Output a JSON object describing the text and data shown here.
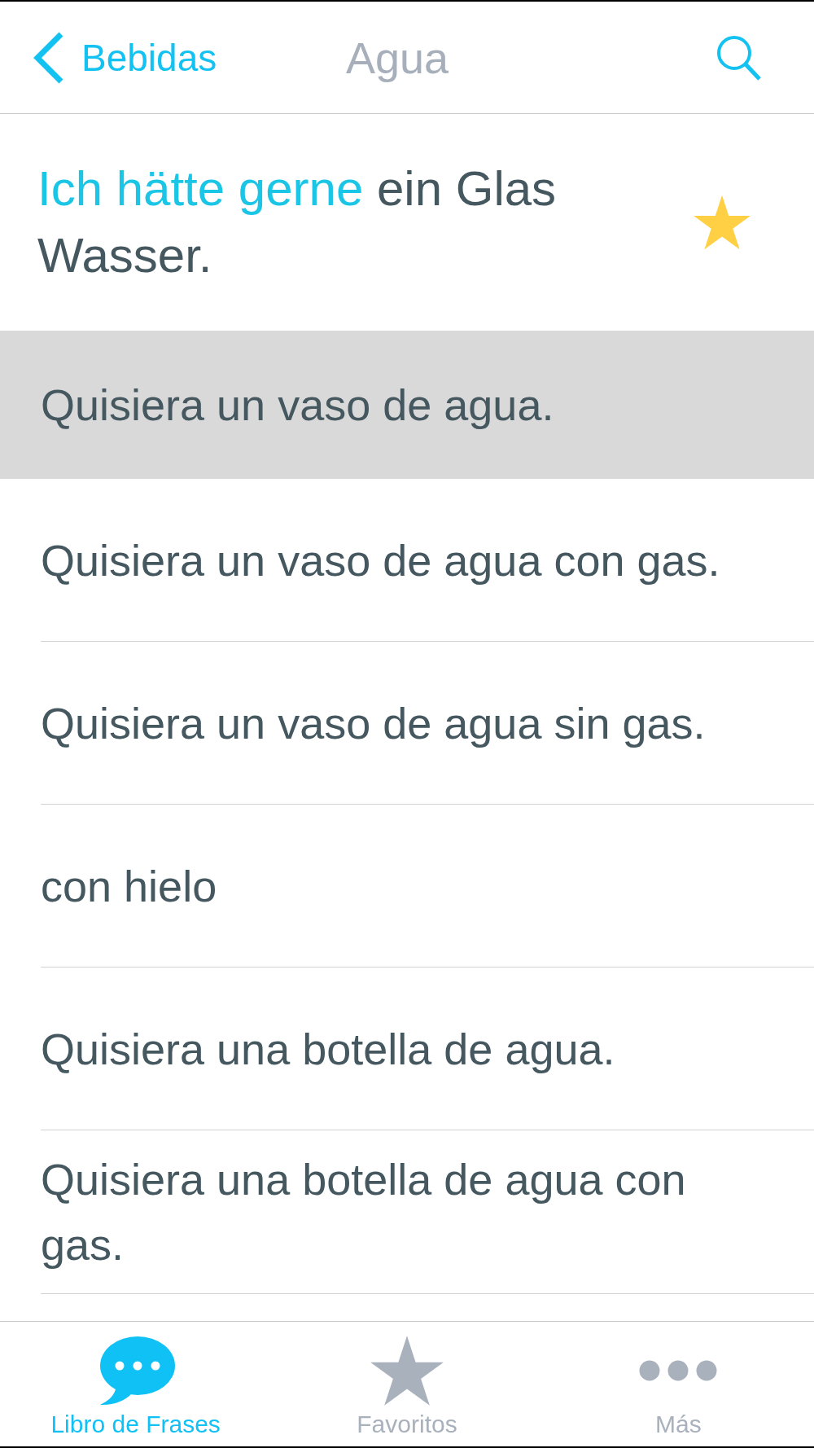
{
  "nav": {
    "back_label": "Bebidas",
    "title": "Agua"
  },
  "phrase": {
    "lead": "Ich hätte gerne",
    "rest": "ein Glas Wasser.",
    "favorite": true
  },
  "translations": [
    {
      "text": "Quisiera un vaso de agua.",
      "selected": true
    },
    {
      "text": "Quisiera un vaso de agua con gas.",
      "selected": false
    },
    {
      "text": "Quisiera un vaso de agua sin gas.",
      "selected": false
    },
    {
      "text": "con hielo",
      "selected": false
    },
    {
      "text": "Quisiera una botella de agua.",
      "selected": false
    },
    {
      "text": "Quisiera una botella de agua con gas.",
      "selected": false
    }
  ],
  "tab_bar": {
    "tabs": [
      {
        "label": "Libro de Frases",
        "kind": "phrasebook",
        "selected": true
      },
      {
        "label": "Favoritos",
        "kind": "favorites",
        "selected": false
      },
      {
        "label": "Más",
        "kind": "more",
        "selected": false
      }
    ]
  }
}
